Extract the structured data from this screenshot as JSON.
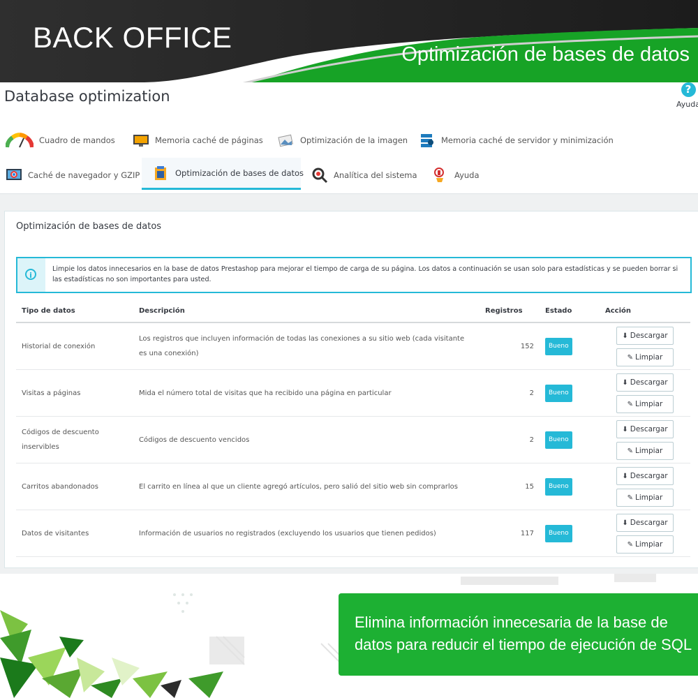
{
  "banner": {
    "title": "BACK OFFICE",
    "subtitle": "Optimización de bases de datos"
  },
  "header": {
    "title": "Database optimization",
    "help_label": "Ayuda",
    "help_icon": "question-circle-icon"
  },
  "tabs": [
    {
      "label": "Cuadro de mandos",
      "icon": "gauge-icon",
      "active": false
    },
    {
      "label": "Memoria caché de páginas",
      "icon": "monitor-html-icon",
      "active": false
    },
    {
      "label": "Optimización de la imagen",
      "icon": "image-icon",
      "active": false
    },
    {
      "label": "Memoria caché de servidor y minimización",
      "icon": "server-icon",
      "active": false
    },
    {
      "label": "Caché de navegador y GZIP",
      "icon": "browser-icon",
      "active": false
    },
    {
      "label": "Optimización de bases de datos",
      "icon": "database-icon",
      "active": true
    },
    {
      "label": "Analítica del sistema",
      "icon": "analytics-icon",
      "active": false
    },
    {
      "label": "Ayuda",
      "icon": "help-bulb-icon",
      "active": false
    }
  ],
  "panel": {
    "heading": "Optimización de bases de datos",
    "alert": "Limpie los datos innecesarios en la base de datos Prestashop para mejorar el tiempo de carga de su página. Los datos a continuación se usan solo para estadísticas y se pueden borrar si las estadísticas no son importantes para usted.",
    "columns": {
      "type": "Tipo de datos",
      "description": "Descripción",
      "records": "Registros",
      "status": "Estado",
      "action": "Acción"
    },
    "download_label": "Descargar",
    "clean_label": "Limpiar",
    "rows": [
      {
        "type": "Historial de conexión",
        "description": "Los registros que incluyen información de todas las conexiones a su sitio web (cada visitante es una conexión)",
        "records": "152",
        "status": "Bueno"
      },
      {
        "type": "Visitas a páginas",
        "description": "Mida el número total de visitas que ha recibido una página en particular",
        "records": "2",
        "status": "Bueno"
      },
      {
        "type": "Códigos de descuento inservibles",
        "description": "Códigos de descuento vencidos",
        "records": "2",
        "status": "Bueno"
      },
      {
        "type": "Carritos abandonados",
        "description": "El carrito en línea al que un cliente agregó artículos, pero salió del sitio web sin comprarlos",
        "records": "15",
        "status": "Bueno"
      },
      {
        "type": "Datos de visitantes",
        "description": "Información de usuarios no registrados (excluyendo los usuarios que tienen pedidos)",
        "records": "117",
        "status": "Bueno"
      }
    ]
  },
  "promo": {
    "text": "Elimina información innecesaria de la base de datos para reducir el tiempo de ejecución de SQL"
  },
  "colors": {
    "banner_dark": "#2b2b2b",
    "banner_green": "#17a326",
    "accent": "#25b9d7",
    "promo_green": "#1db033"
  }
}
